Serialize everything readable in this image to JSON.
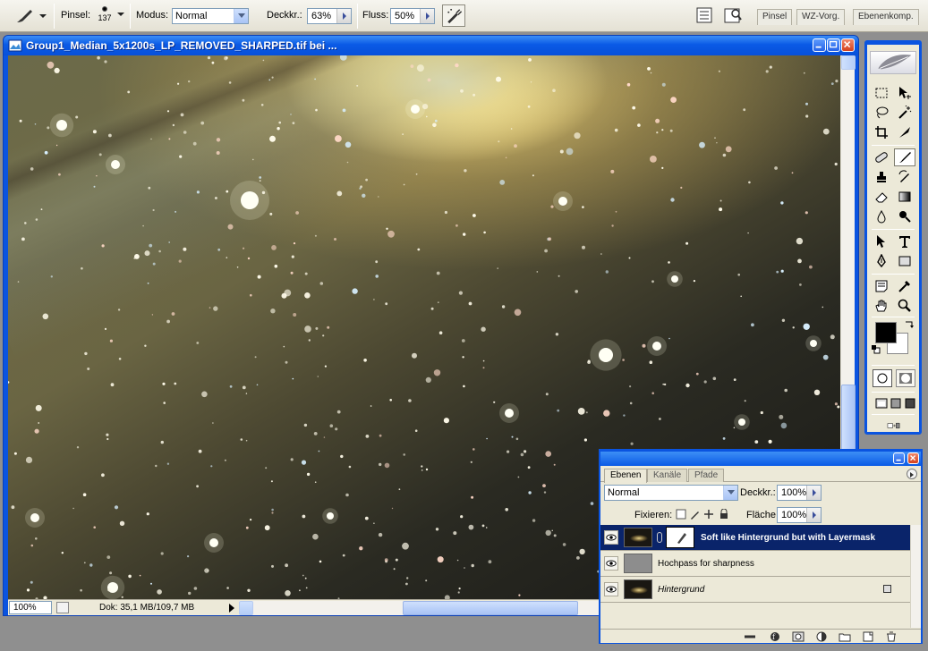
{
  "options_bar": {
    "brush_label": "Pinsel:",
    "brush_size": "137",
    "mode_label": "Modus:",
    "mode_value": "Normal",
    "opacity_label": "Deckkr.:",
    "opacity_value": "63%",
    "flow_label": "Fluss:",
    "flow_value": "50%",
    "palette_well_tabs": [
      "Pinsel",
      "WZ-Vorg.",
      "Ebenenkomp."
    ]
  },
  "document": {
    "title": "Group1_Median_5x1200s_LP_REMOVED_SHARPED.tif bei ...",
    "zoom": "100%",
    "doc_info": "Dok: 35,1 MB/109,7 MB"
  },
  "layers_panel": {
    "tabs": [
      "Ebenen",
      "Kanäle",
      "Pfade"
    ],
    "blend_mode": "Normal",
    "opacity_label": "Deckkr.:",
    "opacity_value": "100%",
    "lock_label": "Fixieren:",
    "fill_label": "Fläche:",
    "fill_value": "100%",
    "layers": [
      {
        "name": "Soft like Hintergrund but with Layermask",
        "selected": true
      },
      {
        "name": "Hochpass for sharpness",
        "selected": false
      },
      {
        "name": "Hintergrund",
        "selected": false
      }
    ]
  },
  "colors": {
    "foreground": "#000000",
    "background": "#ffffff",
    "title_blue": "#0a54e0",
    "selected_layer": "#0a246a"
  }
}
